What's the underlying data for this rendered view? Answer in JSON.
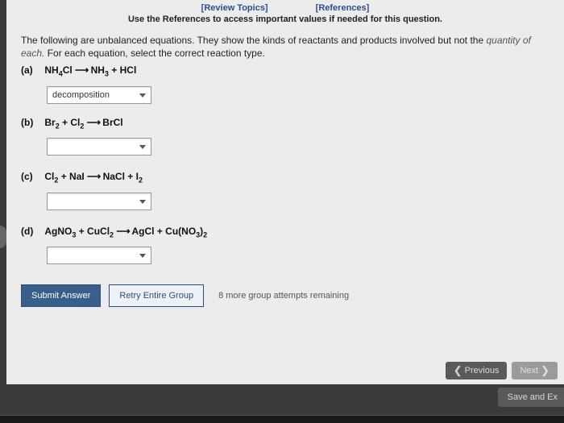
{
  "header": {
    "link_review": "[Review Topics]",
    "link_references": "[References]",
    "hint": "Use the References to access important values if needed for this question."
  },
  "intro": {
    "text_main": "The following are unbalanced equations. They show the kinds of reactants and products involved but not the ",
    "text_tail": "quantity of each.",
    "text_line2": " For each equation, select the correct reaction type."
  },
  "parts": {
    "a": {
      "label": "(a)",
      "equation": "NH₄Cl ⟶ NH₃ + HCl",
      "selected": "decomposition"
    },
    "b": {
      "label": "(b)",
      "equation": "Br₂ + Cl₂ ⟶ BrCl",
      "selected": ""
    },
    "c": {
      "label": "(c)",
      "equation": "Cl₂ + NaI ⟶ NaCl + I₂",
      "selected": ""
    },
    "d": {
      "label": "(d)",
      "equation": "AgNO₃ + CuCl₂ ⟶ AgCl + Cu(NO₃)₂",
      "selected": ""
    }
  },
  "actions": {
    "submit": "Submit Answer",
    "retry": "Retry Entire Group",
    "attempts": "8 more group attempts remaining"
  },
  "nav": {
    "previous": "Previous",
    "next": "Next",
    "save": "Save and Ex"
  }
}
